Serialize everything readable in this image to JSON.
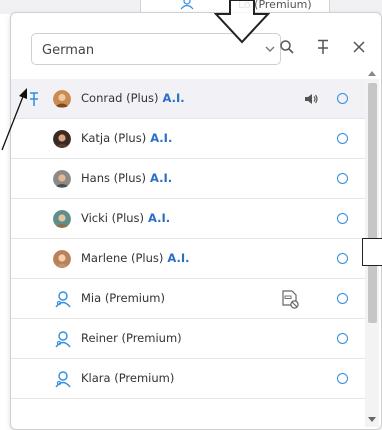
{
  "background": {
    "card_text": "Lo     (Premium)"
  },
  "search": {
    "value": "German"
  },
  "colors": {
    "accent": "#2f8ee0",
    "ai_label": "#2b6fc5",
    "selected_row": "#f2f2f6"
  },
  "contacts": [
    {
      "name": "Conrad (Plus)",
      "badge": "A.I.",
      "type": "photo",
      "pinned": true,
      "speaker": true,
      "selected": true
    },
    {
      "name": "Katja (Plus)",
      "badge": "A.I.",
      "type": "photo"
    },
    {
      "name": "Hans (Plus)",
      "badge": "A.I.",
      "type": "photo"
    },
    {
      "name": "Vicki (Plus)",
      "badge": "A.I.",
      "type": "photo"
    },
    {
      "name": "Marlene (Plus)",
      "badge": "A.I.",
      "type": "photo"
    },
    {
      "name": "Mia (Premium)",
      "badge": "",
      "type": "person-icon",
      "no_card": true
    },
    {
      "name": "Reiner (Premium)",
      "badge": "",
      "type": "person-icon"
    },
    {
      "name": "Klara (Premium)",
      "badge": "",
      "type": "person-icon"
    }
  ]
}
